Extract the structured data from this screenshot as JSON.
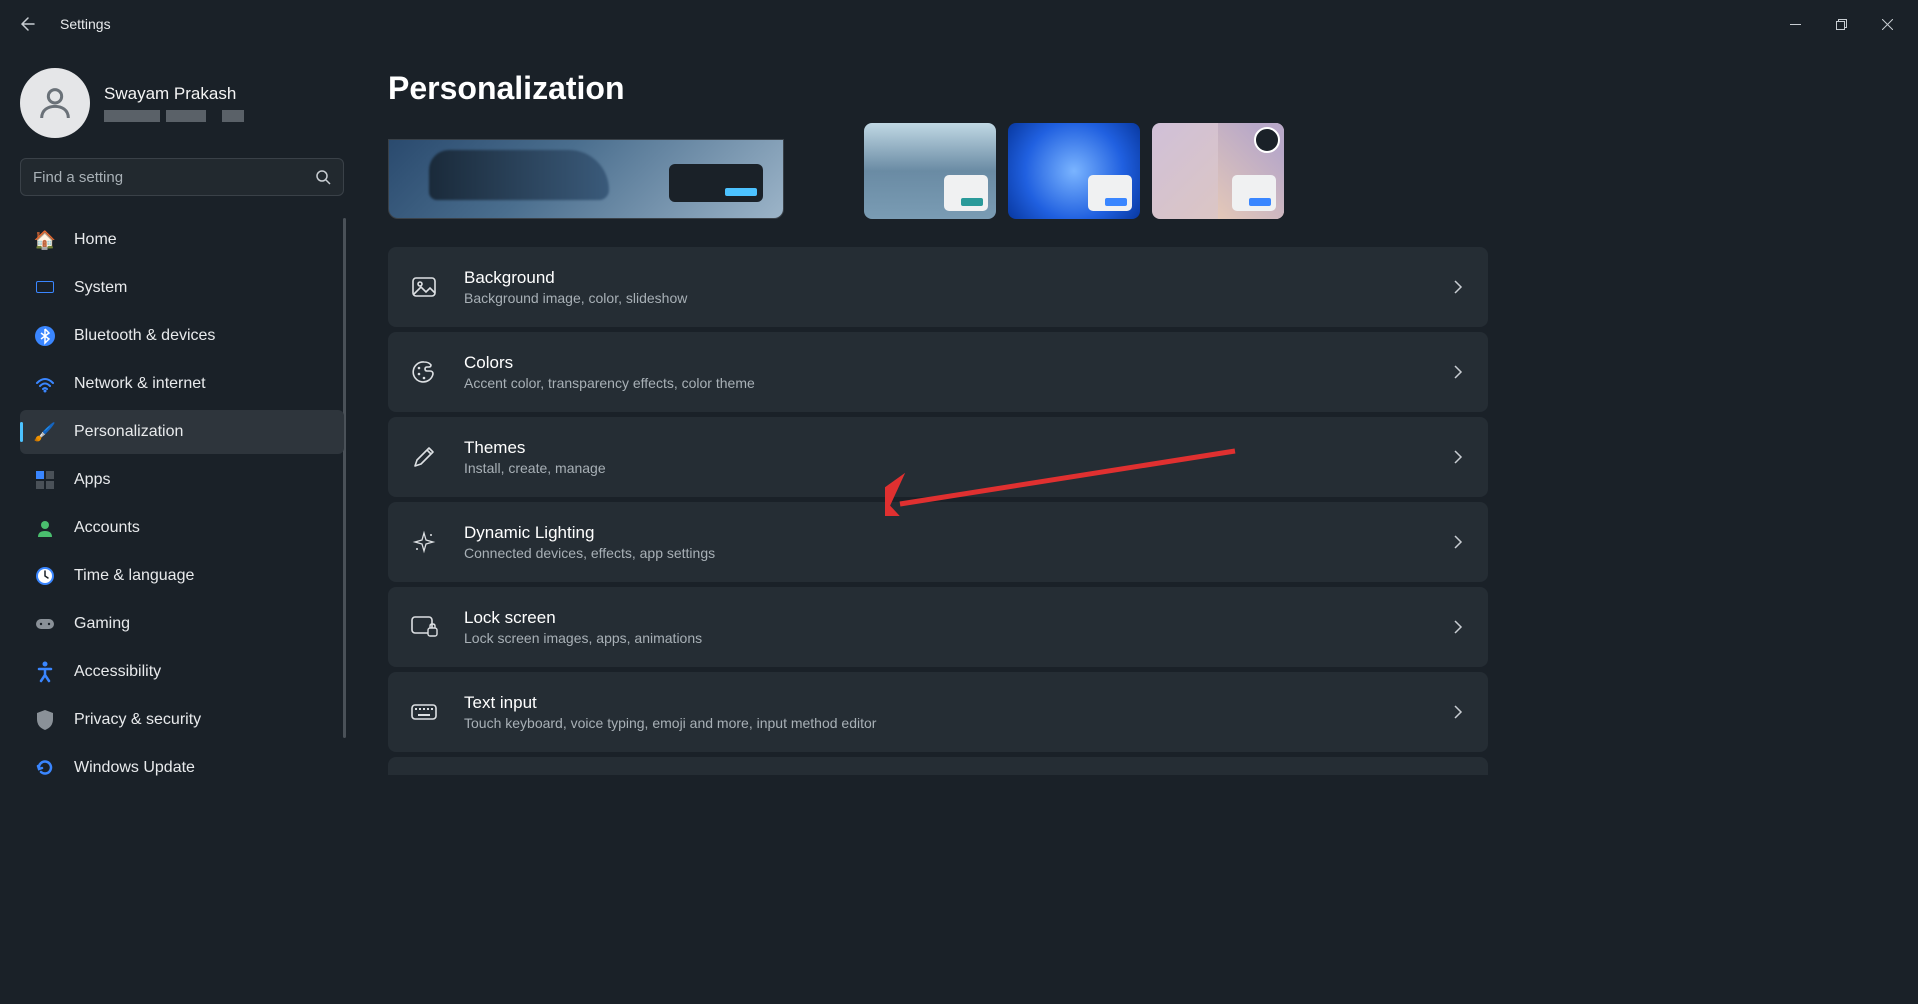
{
  "window": {
    "title": "Settings"
  },
  "user": {
    "name": "Swayam Prakash"
  },
  "search": {
    "placeholder": "Find a setting"
  },
  "nav": [
    {
      "label": "Home",
      "icon": "🏠"
    },
    {
      "label": "System",
      "icon": "💻"
    },
    {
      "label": "Bluetooth & devices",
      "icon": "bt"
    },
    {
      "label": "Network & internet",
      "icon": "wifi"
    },
    {
      "label": "Personalization",
      "icon": "🖌️",
      "active": true
    },
    {
      "label": "Apps",
      "icon": "apps"
    },
    {
      "label": "Accounts",
      "icon": "account"
    },
    {
      "label": "Time & language",
      "icon": "clock"
    },
    {
      "label": "Gaming",
      "icon": "🎮"
    },
    {
      "label": "Accessibility",
      "icon": "access"
    },
    {
      "label": "Privacy & security",
      "icon": "shield"
    },
    {
      "label": "Windows Update",
      "icon": "update"
    }
  ],
  "page": {
    "title": "Personalization"
  },
  "items": [
    {
      "title": "Background",
      "sub": "Background image, color, slideshow",
      "icon": "image"
    },
    {
      "title": "Colors",
      "sub": "Accent color, transparency effects, color theme",
      "icon": "palette"
    },
    {
      "title": "Themes",
      "sub": "Install, create, manage",
      "icon": "pen"
    },
    {
      "title": "Dynamic Lighting",
      "sub": "Connected devices, effects, app settings",
      "icon": "sparkle"
    },
    {
      "title": "Lock screen",
      "sub": "Lock screen images, apps, animations",
      "icon": "lock"
    },
    {
      "title": "Text input",
      "sub": "Touch keyboard, voice typing, emoji and more, input method editor",
      "icon": "keyboard"
    }
  ]
}
